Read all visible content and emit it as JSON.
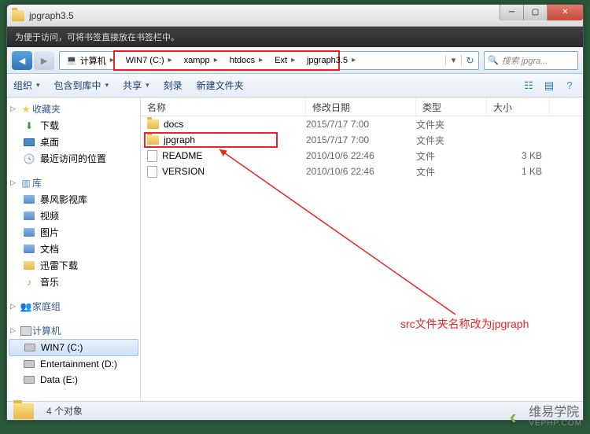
{
  "window": {
    "title": "jpgraph3.5"
  },
  "bookmark_hint": "为便于访问，可将书签直接放在书签栏中。",
  "breadcrumbs": [
    "计算机",
    "WIN7 (C:)",
    "xampp",
    "htdocs",
    "Ext",
    "jpgraph3.5"
  ],
  "search": {
    "placeholder": "搜索 jpgra..."
  },
  "toolbar": {
    "organize": "组织",
    "include": "包含到库中",
    "share": "共享",
    "burn": "刻录",
    "new_folder": "新建文件夹"
  },
  "sidebar": {
    "favorites": {
      "label": "收藏夹",
      "items": [
        "下载",
        "桌面",
        "最近访问的位置"
      ]
    },
    "libraries": {
      "label": "库",
      "items": [
        "暴风影视库",
        "视频",
        "图片",
        "文档",
        "迅雷下载",
        "音乐"
      ]
    },
    "homegroup": {
      "label": "家庭组"
    },
    "computer": {
      "label": "计算机",
      "items": [
        "WIN7 (C:)",
        "Entertainment (D:)",
        "Data (E:)"
      ]
    }
  },
  "columns": {
    "name": "名称",
    "date": "修改日期",
    "type": "类型",
    "size": "大小"
  },
  "files": [
    {
      "name": "docs",
      "date": "2015/7/17 7:00",
      "type": "文件夹",
      "size": "",
      "kind": "folder"
    },
    {
      "name": "jpgraph",
      "date": "2015/7/17 7:00",
      "type": "文件夹",
      "size": "",
      "kind": "folder"
    },
    {
      "name": "README",
      "date": "2010/10/6 22:46",
      "type": "文件",
      "size": "3 KB",
      "kind": "file"
    },
    {
      "name": "VERSION",
      "date": "2010/10/6 22:46",
      "type": "文件",
      "size": "1 KB",
      "kind": "file"
    }
  ],
  "annotation": "src文件夹名称改为jpgraph",
  "status": {
    "count": "4 个对象"
  },
  "watermark": {
    "title": "维易学院",
    "sub": "VEPHP.COM"
  }
}
